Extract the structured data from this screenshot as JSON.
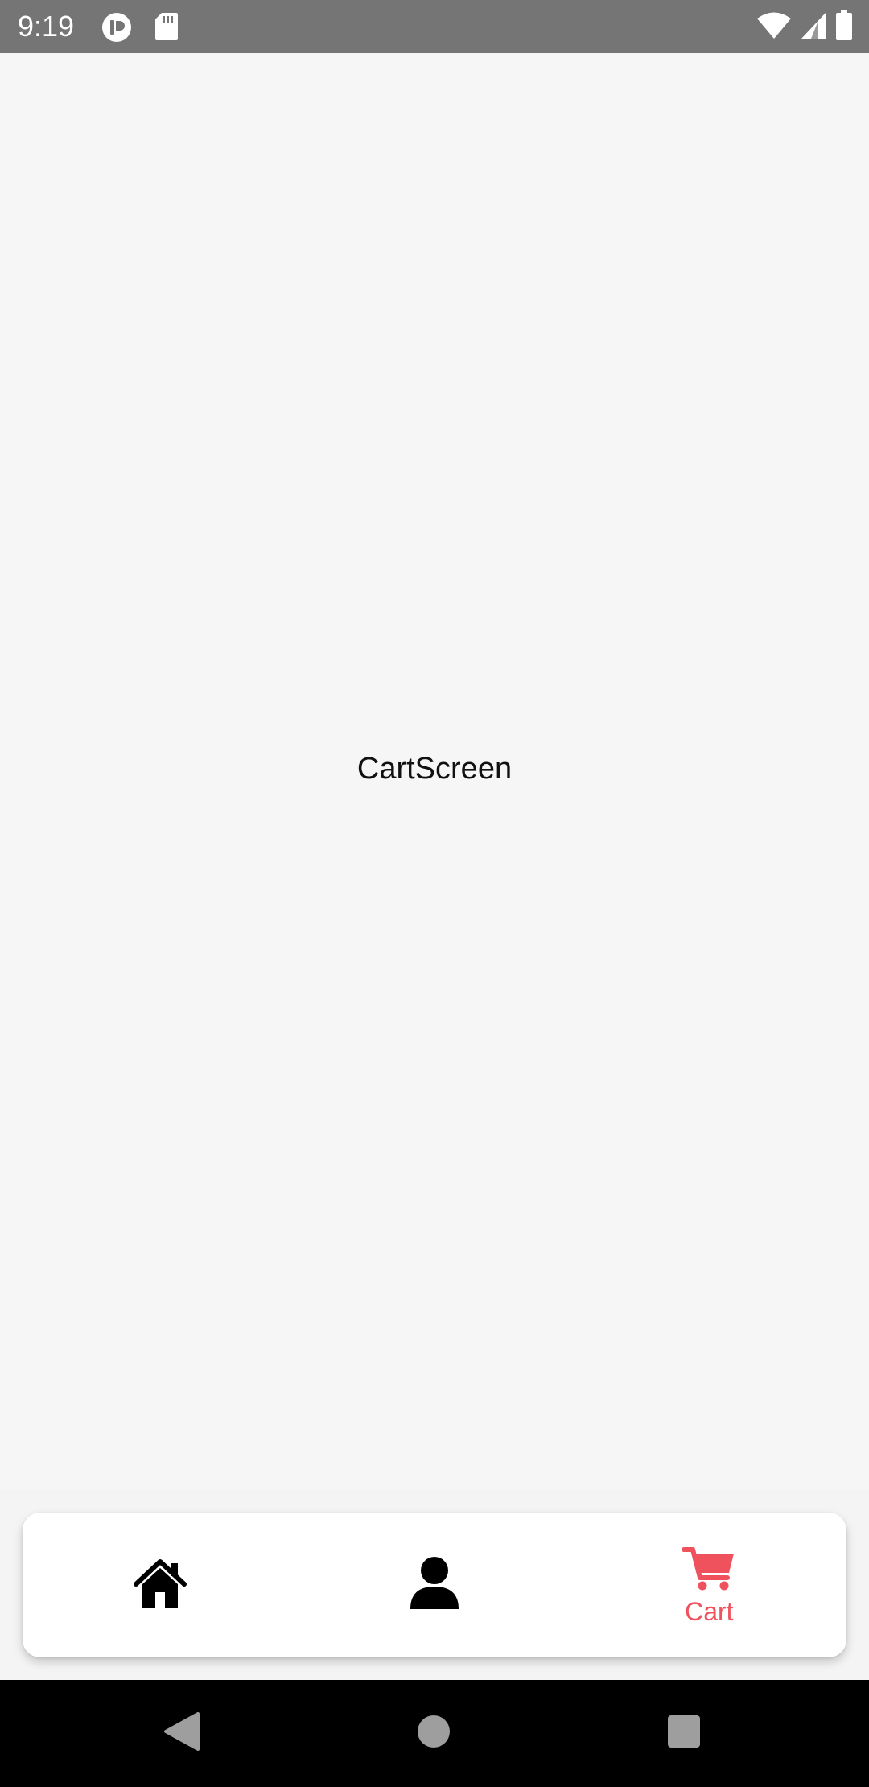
{
  "status_bar": {
    "time": "9:19",
    "left_icons": [
      "app-notification-icon",
      "sd-card-icon"
    ],
    "right_icons": [
      "wifi-icon",
      "cellular-signal-icon",
      "battery-icon"
    ]
  },
  "main": {
    "screen_label": "CartScreen"
  },
  "tab_bar": {
    "active_color": "#f0525d",
    "inactive_color": "#000000",
    "tabs": [
      {
        "icon": "home-icon",
        "label": "",
        "active": false
      },
      {
        "icon": "user-icon",
        "label": "",
        "active": false
      },
      {
        "icon": "cart-icon",
        "label": "Cart",
        "active": true
      }
    ]
  },
  "nav_bar": {
    "buttons": [
      "back-icon",
      "home-circle-icon",
      "recents-icon"
    ]
  }
}
